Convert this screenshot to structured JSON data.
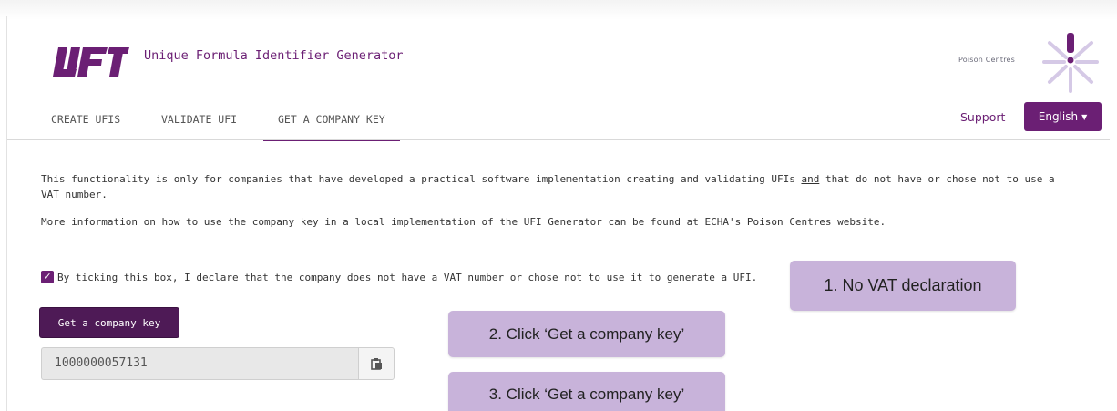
{
  "header": {
    "app_title": "Unique Formula Identifier Generator",
    "logo_icon": "ufi-logo-icon",
    "partner_label": "Poison Centres",
    "partner_icon": "poison-centres-logo-icon"
  },
  "nav": {
    "tabs": [
      {
        "label": "CREATE UFIS",
        "active": false
      },
      {
        "label": "VALIDATE UFI",
        "active": false
      },
      {
        "label": "GET A COMPANY KEY",
        "active": true
      }
    ],
    "support_label": "Support",
    "language_label": "English"
  },
  "content": {
    "para1_a": "This functionality is only for companies that have developed a practical software implementation creating and validating UFIs ",
    "para1_b": "and",
    "para1_c": " that do not have or chose not to use a VAT number.",
    "para2": "More information on how to use the company key in a local implementation of the UFI Generator can be found at ECHA's Poison Centres website.",
    "checkbox_label": "By ticking this box, I declare that the company does not have a VAT number or chose not to use it to generate a UFI.",
    "checkbox_checked": true,
    "get_key_button": "Get a company key",
    "company_key_value": "1000000057131"
  },
  "callouts": {
    "step1": "1. No VAT declaration",
    "step2": "2. Click ‘Get a company key’",
    "step3": "3. Click ‘Get a company key’"
  },
  "colors": {
    "brand": "#6b1f74",
    "callout": "#c8b3da"
  }
}
